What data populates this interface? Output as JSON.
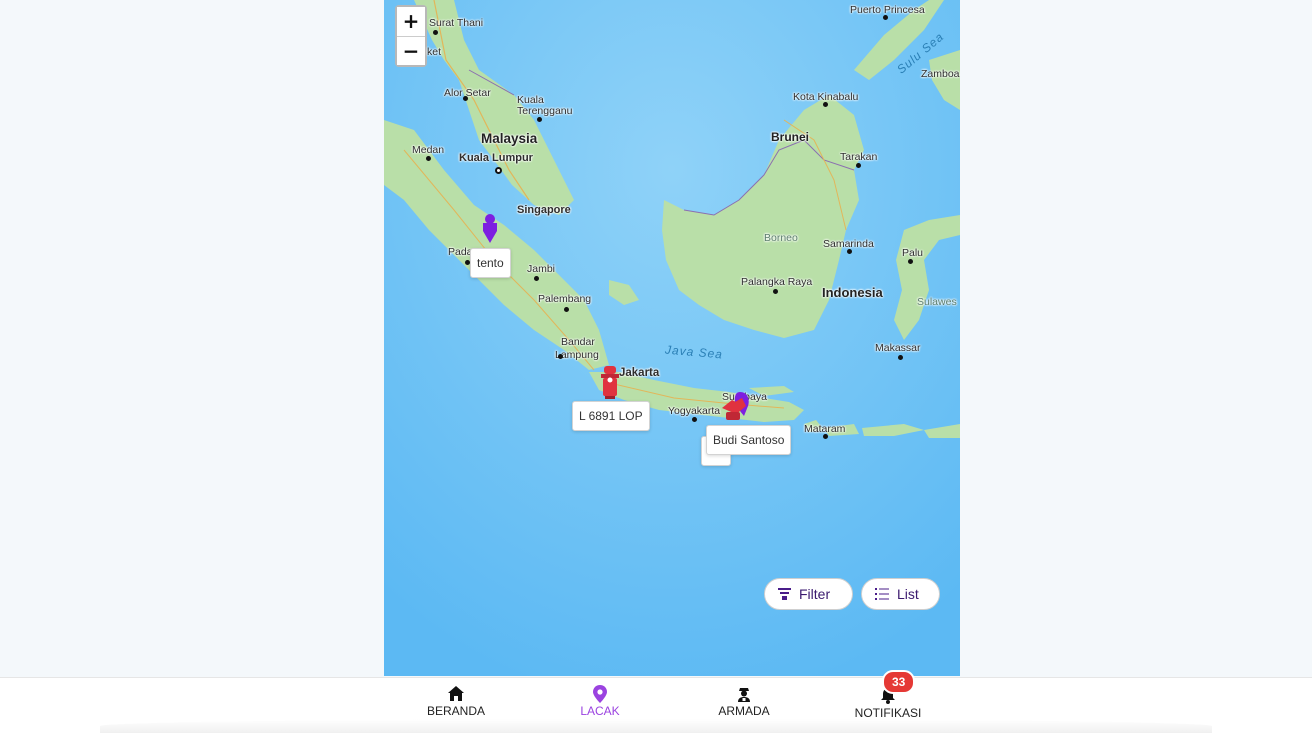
{
  "map": {
    "zoom_in": "+",
    "zoom_out": "−",
    "places": {
      "surat_thani": "Surat Thani",
      "phuket": "ket",
      "alor_setar": "Alor Setar",
      "kuala_terengganu_1": "Kuala",
      "kuala_terengganu_2": "Terengganu",
      "malaysia": "Malaysia",
      "medan": "Medan",
      "kuala_lumpur": "Kuala Lumpur",
      "singapore": "Singapore",
      "padang": "Padang",
      "jambi": "Jambi",
      "palembang": "Palembang",
      "bandar_lampung_1": "Bandar",
      "bandar_lampung_2": "Lampung",
      "jakarta": "Jakarta",
      "yogyakarta": "Yogyakarta",
      "surabaya": "Surabaya",
      "mataram": "Mataram",
      "java_sea": "Java Sea",
      "puerto_princesa": "Puerto Princesa",
      "sulu_sea": "Sulu Sea",
      "zamboanga": "Zamboa",
      "kota_kinabalu": "Kota Kinabalu",
      "brunei": "Brunei",
      "tarakan": "Tarakan",
      "borneo": "Borneo",
      "samarinda": "Samarinda",
      "palangka_raya": "Palangka Raya",
      "indonesia": "Indonesia",
      "palu": "Palu",
      "sulawesi": "Sulawes",
      "makassar": "Makassar"
    },
    "vehicle_labels": {
      "tento": "tento",
      "jakarta_truck": "L 6891 LOP",
      "surabaya_1": "Budi Santoso",
      "surabaya_2": "L 7"
    },
    "filter_label": "Filter",
    "list_label": "List"
  },
  "nav": {
    "items": [
      {
        "label": "BERANDA",
        "icon": "home-icon"
      },
      {
        "label": "LACAK",
        "icon": "location-pin-icon"
      },
      {
        "label": "ARMADA",
        "icon": "driver-icon"
      },
      {
        "label": "NOTIFIKASI",
        "icon": "bell-icon"
      }
    ],
    "notification_count": "33"
  },
  "colors": {
    "sea": "#73c3f5",
    "land": "#b9dfa8",
    "accent": "#9b43e0",
    "marker_red": "#e0323f",
    "marker_purple": "#7d1fe0",
    "badge": "#e53935"
  }
}
